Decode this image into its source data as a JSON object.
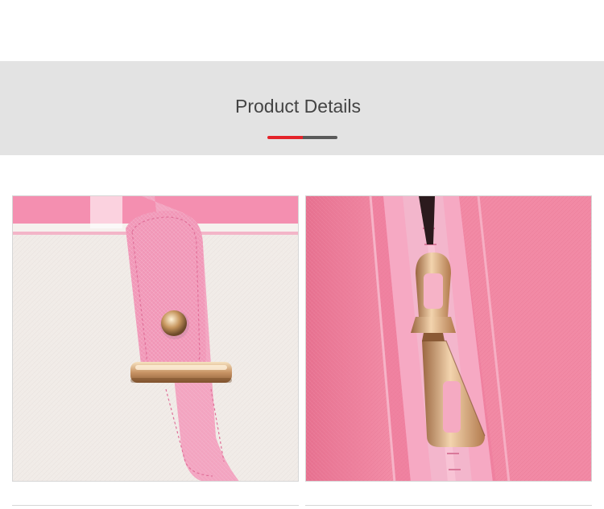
{
  "section": {
    "title": "Product Details"
  },
  "colors": {
    "banner_bg": "#e3e3e3",
    "accent_red": "#e4232a",
    "accent_gray": "#5a5a5a"
  },
  "gallery": {
    "images": [
      {
        "subject": "strap-buckle-detail"
      },
      {
        "subject": "zipper-pull-detail"
      }
    ]
  }
}
